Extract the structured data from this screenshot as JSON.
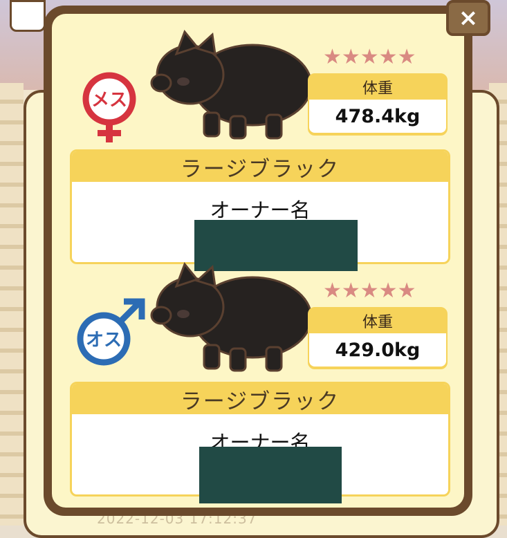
{
  "dialog": {
    "close_label": "×",
    "pigs": [
      {
        "sex": "female",
        "sex_label": "メス",
        "sex_color": "#d6343f",
        "stars": "★★★★★",
        "weight_label": "体重",
        "weight_value": "478.4kg",
        "breed": "ラージブラック",
        "owner_label": "オーナー名"
      },
      {
        "sex": "male",
        "sex_label": "オス",
        "sex_color": "#2c6cb4",
        "stars": "★★★★★",
        "weight_label": "体重",
        "weight_value": "429.0kg",
        "breed": "ラージブラック",
        "owner_label": "オーナー名"
      }
    ]
  },
  "background": {
    "timestamp": "2022-12-03 17:12:37"
  },
  "colors": {
    "frame": "#6b4a2c",
    "panel": "#fdf6c6",
    "header_yellow": "#f6d35a",
    "star_pink": "#d98a82",
    "redaction": "#214a45"
  }
}
